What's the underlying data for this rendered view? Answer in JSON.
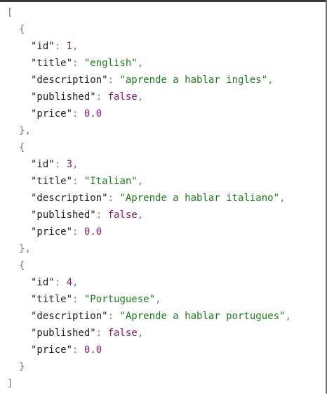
{
  "colors": {
    "background": "#ffffff",
    "punctuation": "#7a7a7a",
    "key": "#202020",
    "string": "#1a7d1a",
    "number": "#8b1e6b",
    "boolean": "#8b1e6b"
  },
  "json": {
    "items": [
      {
        "id_key": "\"id\"",
        "id_value": "1",
        "title_key": "\"title\"",
        "title_value": "\"english\"",
        "description_key": "\"description\"",
        "description_value": "\"aprende a hablar ingles\"",
        "published_key": "\"published\"",
        "published_value": "false",
        "price_key": "\"price\"",
        "price_value": "0.0"
      },
      {
        "id_key": "\"id\"",
        "id_value": "3",
        "title_key": "\"title\"",
        "title_value": "\"Italian\"",
        "description_key": "\"description\"",
        "description_value": "\"Aprende a hablar italiano\"",
        "published_key": "\"published\"",
        "published_value": "false",
        "price_key": "\"price\"",
        "price_value": "0.0"
      },
      {
        "id_key": "\"id\"",
        "id_value": "4",
        "title_key": "\"title\"",
        "title_value": "\"Portuguese\"",
        "description_key": "\"description\"",
        "description_value": "\"Aprende a hablar portugues\"",
        "published_key": "\"published\"",
        "published_value": "false",
        "price_key": "\"price\"",
        "price_value": "0.0"
      }
    ]
  }
}
